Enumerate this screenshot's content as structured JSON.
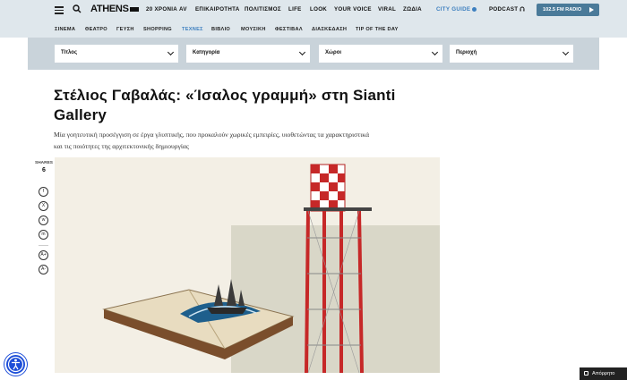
{
  "header": {
    "logo": "ATHENS",
    "nav": [
      "20 ΧΡΟΝΙΑ AV",
      "ΕΠΙΚΑΙΡΟΤΗΤΑ",
      "ΠΟΛΙΤΙΣΜΟΣ",
      "LIFE",
      "LOOK",
      "YOUR VOICE",
      "VIRAL",
      "ΖΩΔΙΑ"
    ],
    "city_guide": "CITY GUIDE",
    "podcast": "PODCAST",
    "radio_button": "102.5 FM RADIO"
  },
  "subnav": {
    "items": [
      "ΣΙΝΕΜΑ",
      "ΘΕΑΤΡΟ",
      "ΓΕΥΣΗ",
      "SHOPPING",
      "ΤΕΧΝΕΣ",
      "ΒΙΒΛΙΟ",
      "ΜΟΥΣΙΚΗ",
      "ΦΕΣΤΙΒΑΛ",
      "ΔΙΑΣΚΕΔΑΣΗ",
      "TIP OF THE DAY"
    ],
    "active": "ΤΕΧΝΕΣ"
  },
  "filters": [
    "Τίτλος",
    "Κατηγορία",
    "Χώροι",
    "Περιοχή"
  ],
  "article": {
    "title": "Στέλιος Γαβαλάς: «Ίσαλος γραμμή» στη Sianti Gallery",
    "lede": "Μία γοητευτική προσέγγιση σε έργα γλυπτικής, που προκαλούν χωρικές εμπειρίες, υιοθετώντας τα χαρακτηριστικά και τις ποιότητες της αρχιτεκτονικής δημιουργίας"
  },
  "share": {
    "label": "SHARES",
    "count": "6",
    "buttons": [
      "f",
      "X",
      "w",
      "m",
      "A+",
      "A-"
    ]
  },
  "cookie_button": "Απόρρητο",
  "colors": {
    "accent": "#3d7fbf",
    "radio": "#4a7a99",
    "nav_bg": "#dfe7ec",
    "filter_bg": "#c9d3da"
  }
}
